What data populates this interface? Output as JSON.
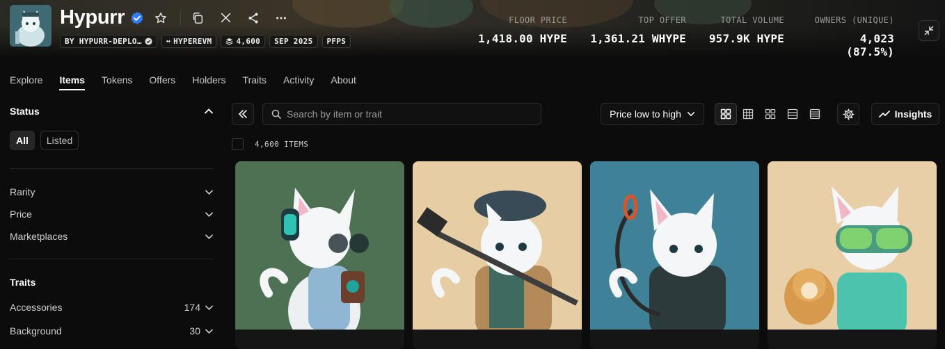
{
  "collection": {
    "name": "Hypurr",
    "chips": [
      {
        "label": "BY HYPURR-DEPLO…",
        "icon": "verified-check-icon"
      },
      {
        "label": "HYPEREVM",
        "icon": "chain-icon"
      },
      {
        "label": "4,600",
        "icon": "stack-icon"
      },
      {
        "label": "SEP 2025",
        "icon": ""
      },
      {
        "label": "PFPS",
        "icon": ""
      }
    ],
    "header_icons": [
      "star-icon",
      "copy-icon",
      "x-icon",
      "share-icon",
      "more-icon"
    ]
  },
  "stats": [
    {
      "label": "FLOOR PRICE",
      "value": "1,418.00 HYPE"
    },
    {
      "label": "TOP OFFER",
      "value": "1,361.21 WHYPE"
    },
    {
      "label": "TOTAL VOLUME",
      "value": "957.9K HYPE"
    },
    {
      "label": "OWNERS (UNIQUE)",
      "value": "4,023 (87.5%)"
    }
  ],
  "tabs": [
    {
      "label": "Explore",
      "active": false
    },
    {
      "label": "Items",
      "active": true
    },
    {
      "label": "Tokens",
      "active": false
    },
    {
      "label": "Offers",
      "active": false
    },
    {
      "label": "Holders",
      "active": false
    },
    {
      "label": "Traits",
      "active": false
    },
    {
      "label": "Activity",
      "active": false
    },
    {
      "label": "About",
      "active": false
    }
  ],
  "sidebar": {
    "status": {
      "title": "Status",
      "options": [
        {
          "label": "All",
          "active": true
        },
        {
          "label": "Listed",
          "active": false
        }
      ]
    },
    "filters": [
      {
        "label": "Rarity"
      },
      {
        "label": "Price"
      },
      {
        "label": "Marketplaces"
      }
    ],
    "traits": {
      "title": "Traits",
      "items": [
        {
          "label": "Accessories",
          "count": "174"
        },
        {
          "label": "Background",
          "count": "30"
        }
      ]
    }
  },
  "toolbar": {
    "search_placeholder": "Search by item or trait",
    "sort_label": "Price low to high",
    "view_icons": [
      "grid-large-icon",
      "grid-small-icon",
      "grid-mixed-icon",
      "list-icon",
      "table-icon"
    ],
    "insights_label": "Insights"
  },
  "items_count": "4,600 ITEMS",
  "cards": [
    {
      "bg": "#4e7153"
    },
    {
      "bg": "#e6cda4"
    },
    {
      "bg": "#3f8297"
    },
    {
      "bg": "#e9cfa7"
    }
  ],
  "colors": {
    "page_bg": "#0c0c0c",
    "verified_blue": "#2d7cf6",
    "text_muted": "#9a9a9a"
  }
}
